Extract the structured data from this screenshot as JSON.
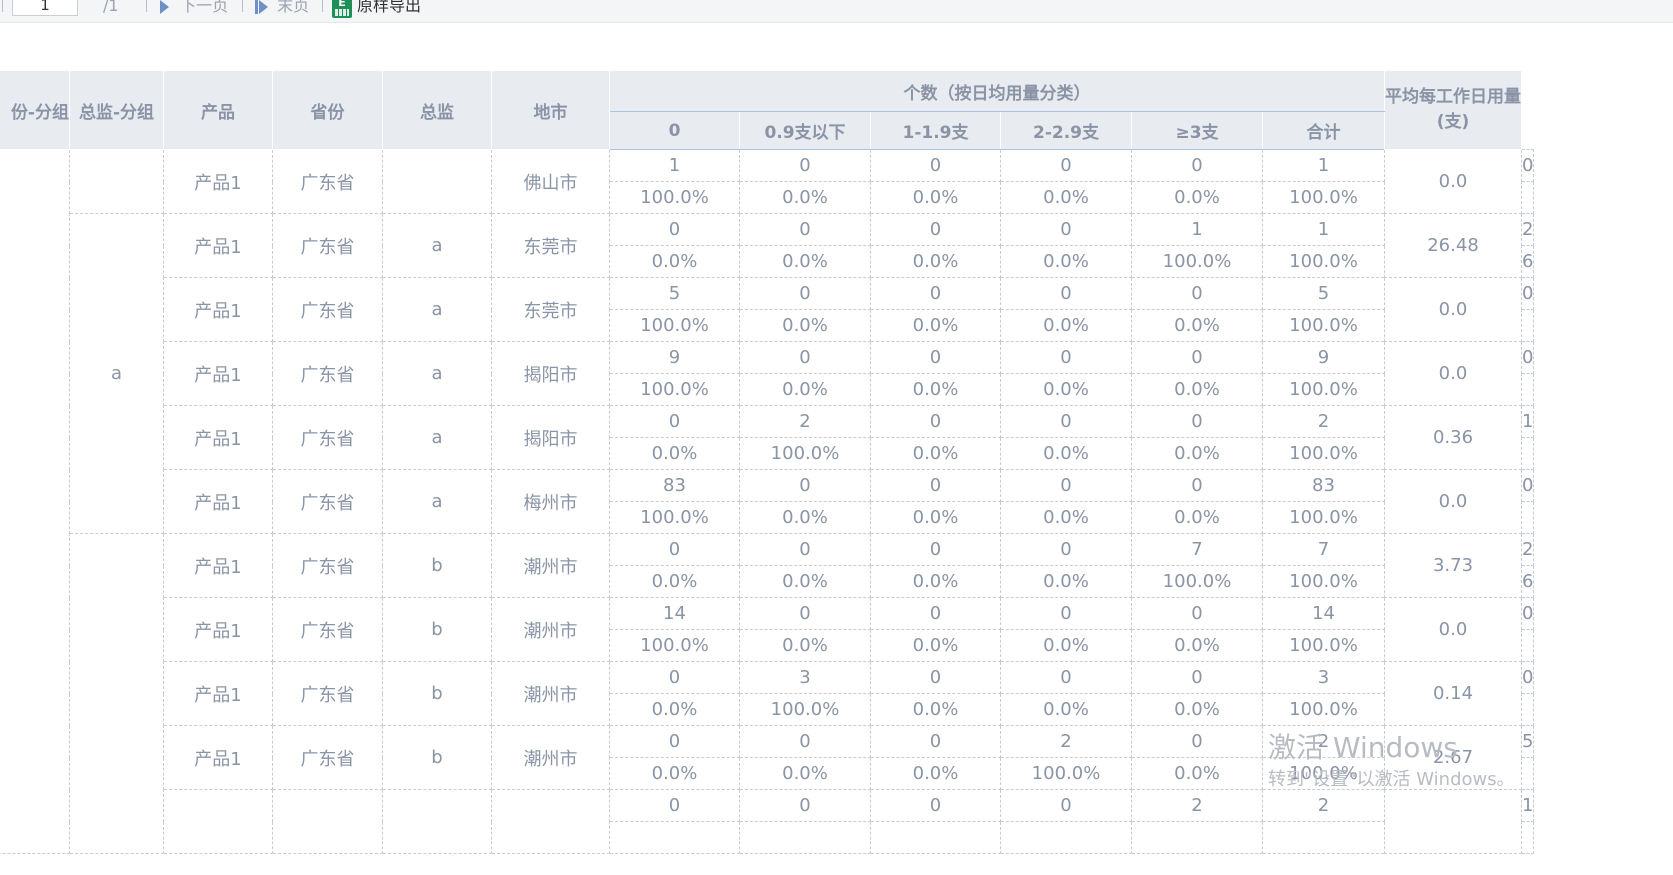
{
  "toolbar": {
    "page_value": "1",
    "page_total": "/1",
    "next_label": "下一页",
    "last_label": "末页",
    "export_label": "原样导出",
    "excel_icon_letter": "E"
  },
  "table": {
    "headers": {
      "c0": "份-分组",
      "c1": "总监-分组",
      "c2": "产品",
      "c3": "省份",
      "c4": "总监",
      "c5": "地市",
      "group": "个数（按日均用量分类）",
      "sub": [
        "0",
        "0.9支以下",
        "1-1.9支",
        "2-2.9支",
        "≥3支",
        "合计"
      ],
      "avg": "平均每工作日用量(支)"
    },
    "group_labels": {
      "a": "a"
    },
    "rows": [
      {
        "product": "产品1",
        "province": "广东省",
        "director": "",
        "city": "佛山市",
        "counts": [
          "1",
          "0",
          "0",
          "0",
          "0",
          "1"
        ],
        "pcts": [
          "100.0%",
          "0.0%",
          "0.0%",
          "0.0%",
          "0.0%",
          "100.0%"
        ],
        "avg": "0.0",
        "tail": [
          "0",
          ""
        ]
      },
      {
        "product": "产品1",
        "province": "广东省",
        "director": "a",
        "city": "东莞市",
        "counts": [
          "0",
          "0",
          "0",
          "0",
          "1",
          "1"
        ],
        "pcts": [
          "0.0%",
          "0.0%",
          "0.0%",
          "0.0%",
          "100.0%",
          "100.0%"
        ],
        "avg": "26.48",
        "tail": [
          "2",
          "6"
        ]
      },
      {
        "product": "产品1",
        "province": "广东省",
        "director": "a",
        "city": "东莞市",
        "counts": [
          "5",
          "0",
          "0",
          "0",
          "0",
          "5"
        ],
        "pcts": [
          "100.0%",
          "0.0%",
          "0.0%",
          "0.0%",
          "0.0%",
          "100.0%"
        ],
        "avg": "0.0",
        "tail": [
          "0",
          ""
        ]
      },
      {
        "product": "产品1",
        "province": "广东省",
        "director": "a",
        "city": "揭阳市",
        "counts": [
          "9",
          "0",
          "0",
          "0",
          "0",
          "9"
        ],
        "pcts": [
          "100.0%",
          "0.0%",
          "0.0%",
          "0.0%",
          "0.0%",
          "100.0%"
        ],
        "avg": "0.0",
        "tail": [
          "0",
          ""
        ]
      },
      {
        "product": "产品1",
        "province": "广东省",
        "director": "a",
        "city": "揭阳市",
        "counts": [
          "0",
          "2",
          "0",
          "0",
          "0",
          "2"
        ],
        "pcts": [
          "0.0%",
          "100.0%",
          "0.0%",
          "0.0%",
          "0.0%",
          "100.0%"
        ],
        "avg": "0.36",
        "tail": [
          "1",
          ""
        ]
      },
      {
        "product": "产品1",
        "province": "广东省",
        "director": "a",
        "city": "梅州市",
        "counts": [
          "83",
          "0",
          "0",
          "0",
          "0",
          "83"
        ],
        "pcts": [
          "100.0%",
          "0.0%",
          "0.0%",
          "0.0%",
          "0.0%",
          "100.0%"
        ],
        "avg": "0.0",
        "tail": [
          "0",
          ""
        ]
      },
      {
        "product": "产品1",
        "province": "广东省",
        "director": "b",
        "city": "潮州市",
        "counts": [
          "0",
          "0",
          "0",
          "0",
          "7",
          "7"
        ],
        "pcts": [
          "0.0%",
          "0.0%",
          "0.0%",
          "0.0%",
          "100.0%",
          "100.0%"
        ],
        "avg": "3.73",
        "tail": [
          "2",
          "6"
        ]
      },
      {
        "product": "产品1",
        "province": "广东省",
        "director": "b",
        "city": "潮州市",
        "counts": [
          "14",
          "0",
          "0",
          "0",
          "0",
          "14"
        ],
        "pcts": [
          "100.0%",
          "0.0%",
          "0.0%",
          "0.0%",
          "0.0%",
          "100.0%"
        ],
        "avg": "0.0",
        "tail": [
          "0",
          ""
        ]
      },
      {
        "product": "产品1",
        "province": "广东省",
        "director": "b",
        "city": "潮州市",
        "counts": [
          "0",
          "3",
          "0",
          "0",
          "0",
          "3"
        ],
        "pcts": [
          "0.0%",
          "100.0%",
          "0.0%",
          "0.0%",
          "0.0%",
          "100.0%"
        ],
        "avg": "0.14",
        "tail": [
          "0",
          ""
        ]
      },
      {
        "product": "产品1",
        "province": "广东省",
        "director": "b",
        "city": "潮州市",
        "counts": [
          "0",
          "0",
          "0",
          "2",
          "0",
          "2"
        ],
        "pcts": [
          "0.0%",
          "0.0%",
          "0.0%",
          "100.0%",
          "0.0%",
          "100.0%"
        ],
        "avg": "2.67",
        "tail": [
          "5",
          ""
        ]
      },
      {
        "product": "",
        "province": "",
        "director": "",
        "city": "",
        "counts": [
          "0",
          "0",
          "0",
          "0",
          "2",
          "2"
        ],
        "pcts": [
          "",
          "",
          "",
          "",
          "",
          ""
        ],
        "avg": "",
        "tail": [
          "1",
          ""
        ]
      }
    ]
  },
  "watermark": {
    "line1": "激活 Windows",
    "line2": "转到\"设置\"以激活 Windows。"
  }
}
